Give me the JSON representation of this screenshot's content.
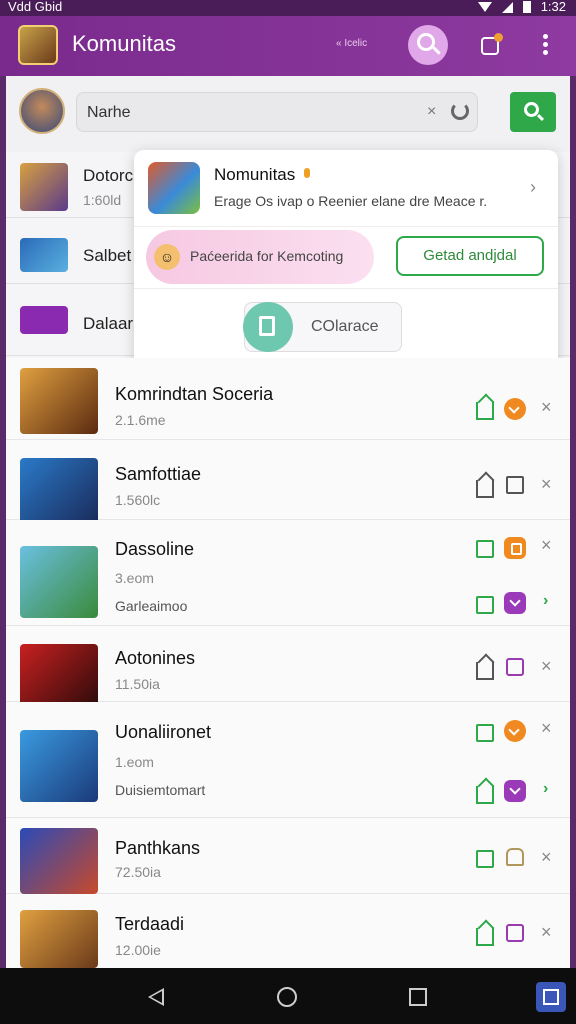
{
  "status_bar": {
    "left_text": "Vdd Gbid",
    "time": "1:32"
  },
  "app_bar": {
    "title": "Komunitas",
    "subtitle": "« Icelic",
    "accent": "#8e3aa0"
  },
  "search": {
    "value": "Narhe",
    "clear": "×"
  },
  "background_list": [
    {
      "title": "Dotorc",
      "sub": "1:60ld"
    },
    {
      "title": "Salbet",
      "sub": ""
    },
    {
      "title": "Dalaar",
      "sub": ""
    }
  ],
  "popup": {
    "title": "Nomunitas",
    "description": "Erage Os ivap o Reenier elane dre Meace r.",
    "chevron": "›",
    "pill_text": "Paćeerida for Kemcoting",
    "pill_emoji": "☺",
    "get_label": "Getad andjdal",
    "cancel_label": "COlarace"
  },
  "games": [
    {
      "title": "Komrindtan Soceria",
      "sub": "2.1.6me",
      "extra": "",
      "a1": "house-green",
      "a2": "orange-check",
      "a3": "x"
    },
    {
      "title": "Samfottiae",
      "sub": "1.560lc",
      "extra": "",
      "a1": "house-grey",
      "a2": "square-grey",
      "a3": "x"
    },
    {
      "title": "Dassoline",
      "sub": "3.eom",
      "extra": "Garleaimoo",
      "a1": "square-green",
      "a2": "orange-lock",
      "a3": "x",
      "b1": "square-green",
      "b2": "purple-check",
      "b3": "chevron"
    },
    {
      "title": "Aotonines",
      "sub": "11.50ia",
      "extra": "",
      "a1": "house-grey",
      "a2": "square-purple",
      "a3": "x"
    },
    {
      "title": "Uonaliironet",
      "sub": "1.eom",
      "extra": "Duisiemtomart",
      "a1": "square-green",
      "a2": "orange-pin",
      "a3": "x",
      "b1": "house-green",
      "b2": "purple-check",
      "b3": "chevron"
    },
    {
      "title": "Panthkans",
      "sub": "72.50ia",
      "extra": "",
      "a1": "square-green",
      "a2": "bell-tan",
      "a3": "x"
    },
    {
      "title": "Terdaadi",
      "sub": "12.00ie",
      "extra": "",
      "a1": "house-green",
      "a2": "square-purple",
      "a3": "x"
    }
  ],
  "x_glyph": "×",
  "chevron_glyph": "›"
}
